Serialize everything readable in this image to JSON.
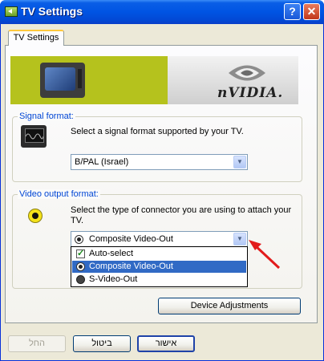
{
  "window": {
    "title": "TV Settings",
    "help_glyph": "?",
    "close_glyph": "✕"
  },
  "tabs": [
    {
      "label": "TV Settings",
      "active": true
    }
  ],
  "banner": {
    "brand": "nVIDIA."
  },
  "signal_format": {
    "legend": "Signal format:",
    "description": "Select a signal format supported by your TV.",
    "selected": "B/PAL (Israel)",
    "icon": "tv-monitor-icon"
  },
  "video_output": {
    "legend": "Video output format:",
    "description": "Select the type of connector you are using to attach your TV.",
    "selected": "Composite Video-Out",
    "icon": "rca-connector-icon",
    "options": [
      {
        "label": "Auto-select",
        "icon": "checkmark-icon"
      },
      {
        "label": "Composite Video-Out",
        "icon": "composite-connector-icon",
        "selected": true
      },
      {
        "label": "S-Video-Out",
        "icon": "svideo-connector-icon"
      }
    ]
  },
  "buttons": {
    "device_adjustments": "Device Adjustments",
    "ok": "אישור",
    "cancel": "ביטול",
    "apply": "החל"
  },
  "colors": {
    "accent_blue": "#0054e3",
    "banner_green": "#b5c21d",
    "selection": "#316ac5",
    "legend_text": "#0046d5",
    "arrow_red": "#e21b1b"
  }
}
